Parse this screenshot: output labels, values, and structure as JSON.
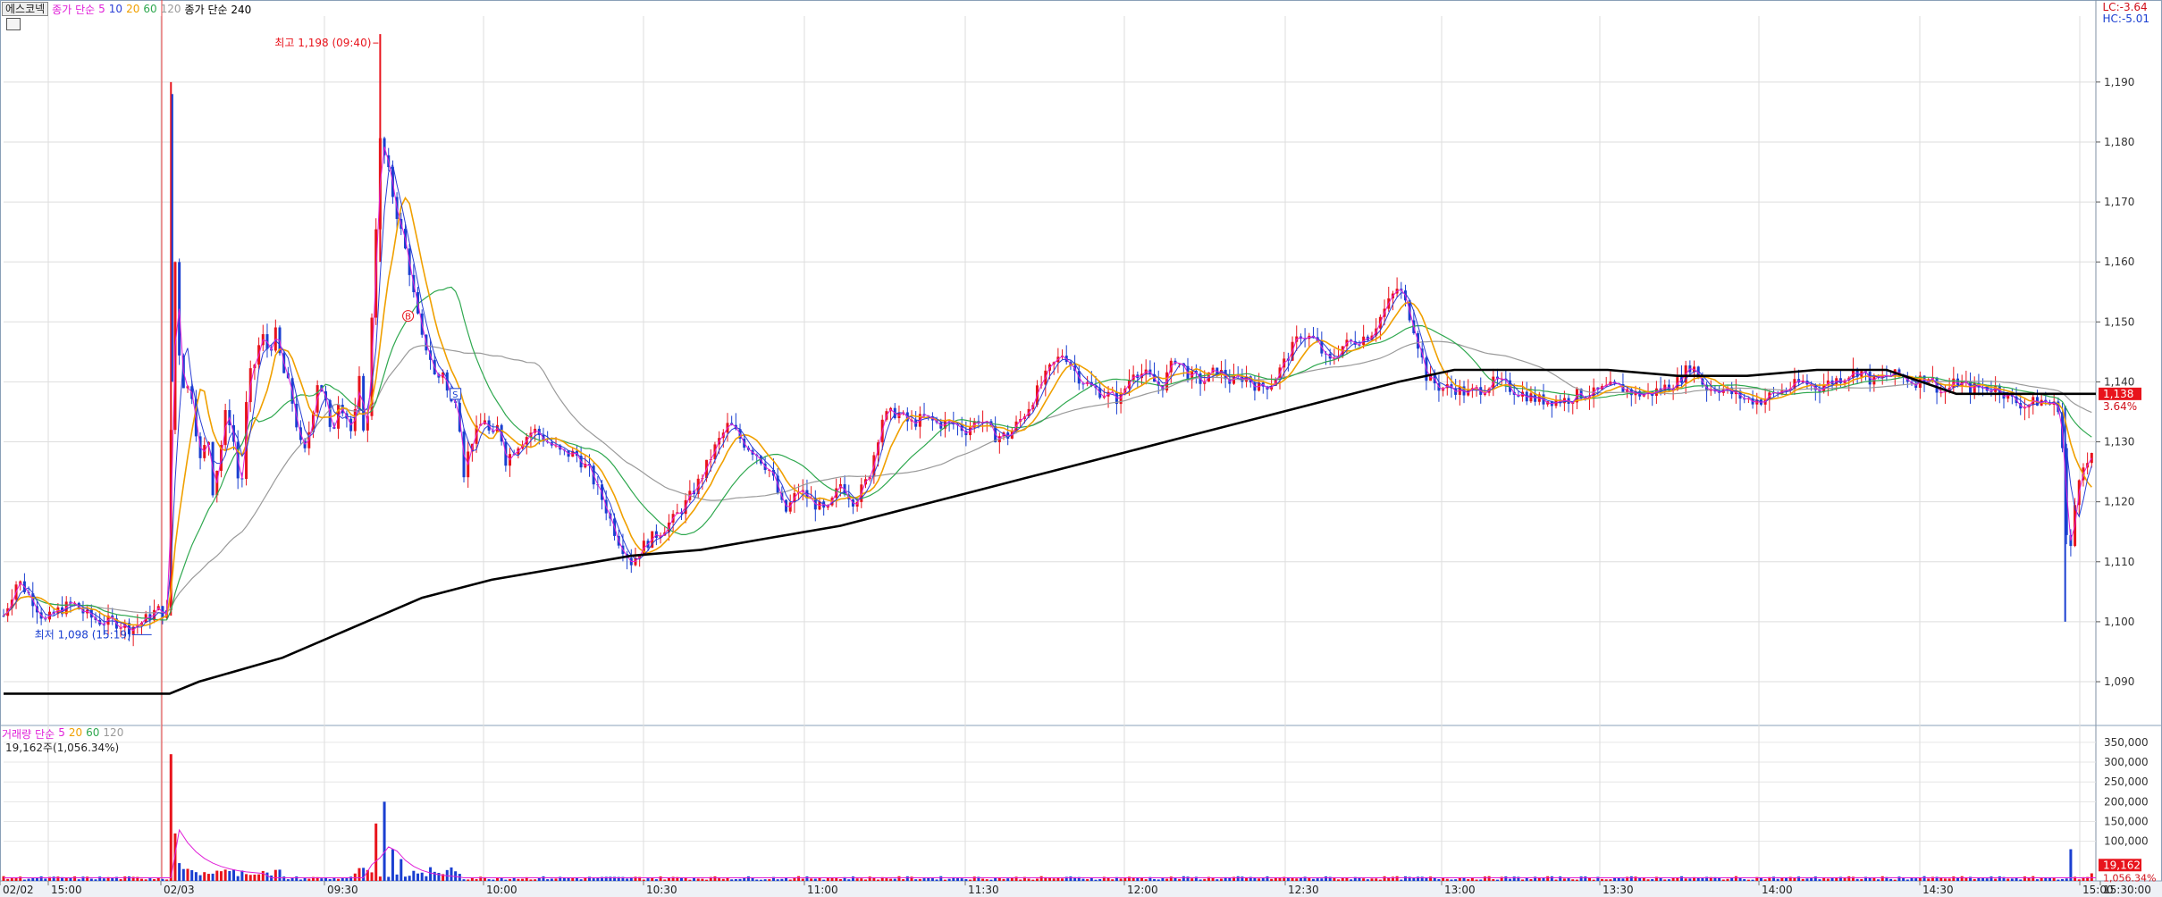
{
  "toolbar": {
    "stock_name": "에스코넥",
    "ma_label": "종가 단순",
    "ma_periods": [
      "5",
      "10",
      "20",
      "60",
      "120"
    ],
    "ma_long_label": "종가 단순 240"
  },
  "limits": {
    "lc": "LC:-3.64",
    "hc": "HC:-5.01"
  },
  "volume_toolbar": {
    "label": "거래량",
    "ma_label": "단순",
    "ma_periods": [
      "5",
      "20",
      "60",
      "120"
    ],
    "info": "19,162주(1,056.34%)"
  },
  "colors": {
    "up": "#e8141c",
    "down": "#1a3fd1",
    "ma5": "#e020d8",
    "ma10": "#2a3fd6",
    "ma20": "#f0a000",
    "ma60": "#2fa84f",
    "ma120": "#9a9a9a",
    "ma240": "#000000"
  },
  "chart_data": [
    {
      "type": "candlestick",
      "title": "에스코넥",
      "y_ticks": [
        "1,090",
        "1,100",
        "1,110",
        "1,120",
        "1,130",
        "1,140",
        "1,150",
        "1,160",
        "1,170",
        "1,180",
        "1,190"
      ],
      "ylim": [
        1083,
        1201
      ],
      "x_ticks": [
        "02/02",
        "15:00",
        "02/03",
        "09:30",
        "10:00",
        "10:30",
        "11:00",
        "11:30",
        "12:00",
        "12:30",
        "13:00",
        "13:30",
        "14:00",
        "14:30",
        "15:00",
        "15:30:00"
      ],
      "grid": true,
      "annotations": {
        "high": "최고 1,198 (09:40)",
        "low": "최저 1,098 (15:19)",
        "marker_b": "B",
        "marker_s": "S"
      },
      "current_price": {
        "value": "1,138",
        "change": "3.64%"
      },
      "price_path": [
        [
          0,
          1101
        ],
        [
          10,
          1107
        ],
        [
          20,
          1104
        ],
        [
          30,
          1100
        ],
        [
          40,
          1102
        ],
        [
          50,
          1103
        ],
        [
          60,
          1101
        ],
        [
          70,
          1100
        ],
        [
          80,
          1100
        ],
        [
          90,
          1099
        ],
        [
          100,
          1100
        ],
        [
          110,
          1102
        ],
        [
          119,
          1101
        ],
        [
          120,
          1132
        ],
        [
          121,
          1188
        ],
        [
          123,
          1160
        ],
        [
          126,
          1145
        ],
        [
          130,
          1138
        ],
        [
          134,
          1140
        ],
        [
          138,
          1132
        ],
        [
          142,
          1125
        ],
        [
          146,
          1133
        ],
        [
          150,
          1122
        ],
        [
          155,
          1128
        ],
        [
          160,
          1136
        ],
        [
          165,
          1130
        ],
        [
          170,
          1120
        ],
        [
          175,
          1140
        ],
        [
          180,
          1143
        ],
        [
          185,
          1148
        ],
        [
          190,
          1145
        ],
        [
          195,
          1148
        ],
        [
          200,
          1142
        ],
        [
          205,
          1139
        ],
        [
          210,
          1133
        ],
        [
          215,
          1127
        ],
        [
          220,
          1133
        ],
        [
          225,
          1140
        ],
        [
          230,
          1138
        ],
        [
          235,
          1130
        ],
        [
          240,
          1137
        ],
        [
          245,
          1135
        ],
        [
          250,
          1131
        ],
        [
          255,
          1140
        ],
        [
          260,
          1128
        ],
        [
          265,
          1157
        ],
        [
          270,
          1180
        ],
        [
          275,
          1176
        ],
        [
          280,
          1170
        ],
        [
          285,
          1165
        ],
        [
          290,
          1160
        ],
        [
          295,
          1153
        ],
        [
          300,
          1147
        ],
        [
          305,
          1145
        ],
        [
          310,
          1140
        ],
        [
          315,
          1142
        ],
        [
          320,
          1136
        ],
        [
          325,
          1138
        ],
        [
          330,
          1125
        ],
        [
          335,
          1130
        ],
        [
          340,
          1132
        ],
        [
          345,
          1134
        ],
        [
          350,
          1130
        ],
        [
          355,
          1133
        ],
        [
          360,
          1127
        ],
        [
          370,
          1130
        ],
        [
          380,
          1132
        ],
        [
          390,
          1130
        ],
        [
          400,
          1128
        ],
        [
          410,
          1128
        ],
        [
          420,
          1125
        ],
        [
          430,
          1120
        ],
        [
          440,
          1114
        ],
        [
          450,
          1110
        ],
        [
          460,
          1113
        ],
        [
          470,
          1115
        ],
        [
          480,
          1117
        ],
        [
          490,
          1120
        ],
        [
          500,
          1124
        ],
        [
          510,
          1129
        ],
        [
          520,
          1133
        ],
        [
          530,
          1130
        ],
        [
          540,
          1128
        ],
        [
          550,
          1125
        ],
        [
          560,
          1118
        ],
        [
          570,
          1122
        ],
        [
          580,
          1120
        ],
        [
          590,
          1118
        ],
        [
          600,
          1123
        ],
        [
          610,
          1120
        ],
        [
          620,
          1124
        ],
        [
          630,
          1134
        ],
        [
          640,
          1135
        ],
        [
          650,
          1133
        ],
        [
          660,
          1134
        ],
        [
          670,
          1133
        ],
        [
          680,
          1133
        ],
        [
          690,
          1132
        ],
        [
          700,
          1134
        ],
        [
          710,
          1131
        ],
        [
          720,
          1131
        ],
        [
          730,
          1134
        ],
        [
          740,
          1138
        ],
        [
          750,
          1142
        ],
        [
          760,
          1145
        ],
        [
          770,
          1141
        ],
        [
          780,
          1139
        ],
        [
          790,
          1138
        ],
        [
          800,
          1137
        ],
        [
          810,
          1142
        ],
        [
          820,
          1141
        ],
        [
          830,
          1139
        ],
        [
          840,
          1144
        ],
        [
          850,
          1141
        ],
        [
          860,
          1140
        ],
        [
          870,
          1142
        ],
        [
          880,
          1140
        ],
        [
          890,
          1141
        ],
        [
          900,
          1139
        ],
        [
          910,
          1140
        ],
        [
          920,
          1144
        ],
        [
          930,
          1148
        ],
        [
          940,
          1147
        ],
        [
          950,
          1143
        ],
        [
          960,
          1146
        ],
        [
          970,
          1147
        ],
        [
          980,
          1148
        ],
        [
          990,
          1152
        ],
        [
          1000,
          1156
        ],
        [
          1010,
          1150
        ],
        [
          1020,
          1141
        ],
        [
          1030,
          1139
        ],
        [
          1040,
          1139
        ],
        [
          1050,
          1138
        ],
        [
          1060,
          1139
        ],
        [
          1070,
          1140
        ],
        [
          1080,
          1139
        ],
        [
          1090,
          1138
        ],
        [
          1100,
          1137
        ],
        [
          1110,
          1137
        ],
        [
          1120,
          1137
        ],
        [
          1130,
          1138
        ],
        [
          1140,
          1138
        ],
        [
          1150,
          1139
        ],
        [
          1160,
          1139
        ],
        [
          1170,
          1138
        ],
        [
          1180,
          1138
        ],
        [
          1190,
          1139
        ],
        [
          1200,
          1140
        ],
        [
          1210,
          1143
        ],
        [
          1220,
          1139
        ],
        [
          1230,
          1139
        ],
        [
          1240,
          1138
        ],
        [
          1250,
          1137
        ],
        [
          1260,
          1137
        ],
        [
          1270,
          1138
        ],
        [
          1280,
          1139
        ],
        [
          1290,
          1140
        ],
        [
          1300,
          1139
        ],
        [
          1310,
          1140
        ],
        [
          1320,
          1141
        ],
        [
          1330,
          1142
        ],
        [
          1340,
          1140
        ],
        [
          1350,
          1141
        ],
        [
          1360,
          1141
        ],
        [
          1370,
          1140
        ],
        [
          1380,
          1141
        ],
        [
          1390,
          1138
        ],
        [
          1400,
          1140
        ],
        [
          1410,
          1139
        ],
        [
          1420,
          1139
        ],
        [
          1430,
          1139
        ],
        [
          1440,
          1137
        ],
        [
          1450,
          1136
        ],
        [
          1460,
          1137
        ],
        [
          1470,
          1136
        ],
        [
          1475,
          1136
        ],
        [
          1478,
          1115
        ],
        [
          1482,
          1112
        ],
        [
          1486,
          1122
        ],
        [
          1490,
          1127
        ],
        [
          1494,
          1126
        ],
        [
          1497,
          1128
        ]
      ],
      "ma240_path": [
        [
          0,
          1088
        ],
        [
          110,
          1088
        ],
        [
          119,
          1088
        ],
        [
          140,
          1090
        ],
        [
          200,
          1094
        ],
        [
          260,
          1100
        ],
        [
          300,
          1104
        ],
        [
          350,
          1107
        ],
        [
          400,
          1109
        ],
        [
          450,
          1111
        ],
        [
          500,
          1112
        ],
        [
          550,
          1114
        ],
        [
          600,
          1116
        ],
        [
          650,
          1119
        ],
        [
          700,
          1122
        ],
        [
          750,
          1125
        ],
        [
          800,
          1128
        ],
        [
          850,
          1131
        ],
        [
          900,
          1134
        ],
        [
          950,
          1137
        ],
        [
          1000,
          1140
        ],
        [
          1040,
          1142
        ],
        [
          1100,
          1142
        ],
        [
          1150,
          1142
        ],
        [
          1200,
          1141
        ],
        [
          1250,
          1141
        ],
        [
          1300,
          1142
        ],
        [
          1350,
          1142
        ],
        [
          1400,
          1138
        ],
        [
          1450,
          1138
        ],
        [
          1500,
          1138
        ]
      ]
    },
    {
      "type": "bar",
      "title": "거래량",
      "y_ticks": [
        "100,000",
        "150,000",
        "200,000",
        "250,000",
        "300,000",
        "350,000"
      ],
      "ylim": [
        0,
        370000
      ],
      "current_volume": {
        "value": "19,162",
        "ratio": "1,056.34%"
      },
      "spikes": [
        [
          120,
          320000
        ],
        [
          123,
          120000
        ],
        [
          126,
          45000
        ],
        [
          130,
          30000
        ],
        [
          268,
          145000
        ],
        [
          274,
          200000
        ],
        [
          280,
          80000
        ],
        [
          286,
          55000
        ],
        [
          1481,
          80000
        ],
        [
          1498,
          19162
        ]
      ]
    }
  ]
}
